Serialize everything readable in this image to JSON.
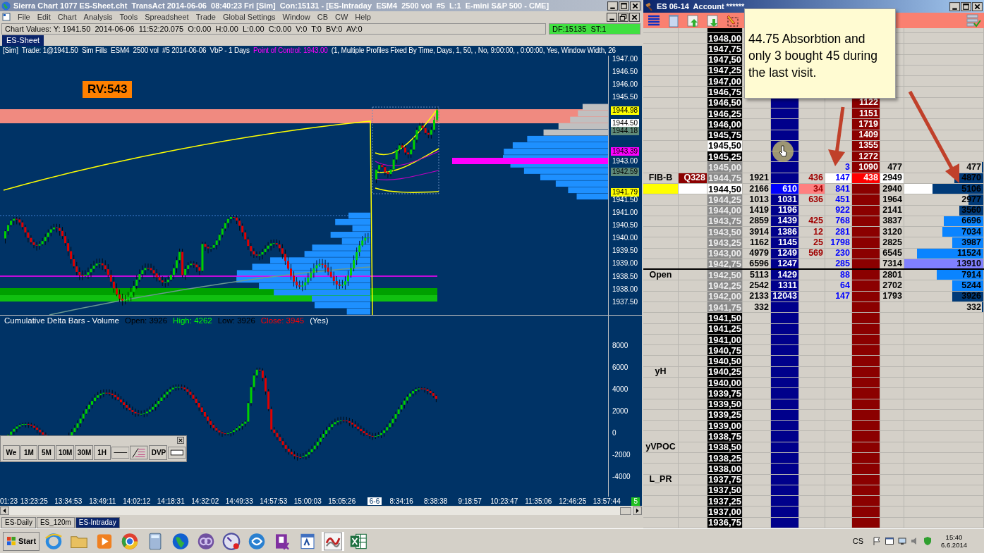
{
  "chart_window": {
    "title": "Sierra Chart 1077 ES-Sheet.cht  TransAct 2014-06-06  08:40:23 Fri [Sim]  Con:15131 - [ES-Intraday  ESM4  2500 vol  #5  L:1  E-mini S&P 500 - CME]",
    "menu": [
      "File",
      "Edit",
      "Chart",
      "Analysis",
      "Tools",
      "Spreadsheet",
      "Trade",
      "Global Settings",
      "Window",
      "CB",
      "CW",
      "Help"
    ],
    "chart_values": "Chart Values: Y: 1941.50  2014-06-06  11:52:20.075  O:0.00  H:0.00  L:0.00  C:0.00  V:0  T:0  BV:0  AV:0",
    "status": "DF:15135  ST:1",
    "sheet_tabs": [
      {
        "label": "ES-Sheet",
        "selected": true
      }
    ],
    "study_info": [
      {
        "text": "[Sim]  Trade: 1@1941.50  Sim Fills  ESM4  2500 vol  #5 2014-06-06  VbP - 1 Days  ",
        "color": "#ffffff"
      },
      {
        "text": "Point of Control: 1943.00",
        "color": "#ff00ff"
      },
      {
        "text": "  (1, Multiple Profiles Fixed By Time, Days, 1, 50, , No, 9:00:00, , 0:00:00, Yes, Window Width, 26",
        "color": "#ffffff"
      }
    ],
    "rv_badge": "RV:543",
    "price_axis": [
      "1947.00",
      "1946.50",
      "1946.00",
      "1945.50",
      "1943.00",
      "1941.50",
      "1941.00",
      "1940.50",
      "1940.00",
      "1939.50",
      "1939.00",
      "1938.50",
      "1938.00",
      "1937.50"
    ],
    "price_markers": [
      {
        "text": "1944.98",
        "color": "#ffff00"
      },
      {
        "text": "1944.50",
        "color": "#ffffff"
      },
      {
        "text": "1944.18",
        "color": "#5f8a7a"
      },
      {
        "text": "1943.39",
        "color": "#ff00ff"
      },
      {
        "text": "1942.59",
        "color": "#5f8a7a"
      },
      {
        "text": "1941.79",
        "color": "#ffff00"
      }
    ],
    "delta_info": [
      {
        "text": "Cumulative Delta Bars - Volume",
        "color": "#ffffff"
      },
      {
        "text": "Open: 3926",
        "color": "#000000"
      },
      {
        "text": "High: 4262",
        "color": "#00ff00"
      },
      {
        "text": "Low: 3926",
        "color": "#000000"
      },
      {
        "text": "Close: 3945",
        "color": "#ff0000"
      },
      {
        "text": "(Yes)",
        "color": "#ffffff"
      }
    ],
    "delta_axis": [
      "8000",
      "6000",
      "4000",
      "2000",
      "0",
      "-2000",
      "-4000"
    ],
    "time_axis": [
      {
        "text": "01:23",
        "kind": "time"
      },
      {
        "text": "13:23:25",
        "kind": "time"
      },
      {
        "text": "13:34:53",
        "kind": "time"
      },
      {
        "text": "13:49:11",
        "kind": "time"
      },
      {
        "text": "14:02:12",
        "kind": "time"
      },
      {
        "text": "14:18:31",
        "kind": "time"
      },
      {
        "text": "14:32:02",
        "kind": "time"
      },
      {
        "text": "14:49:33",
        "kind": "time"
      },
      {
        "text": "14:57:53",
        "kind": "time"
      },
      {
        "text": "15:00:03",
        "kind": "time"
      },
      {
        "text": "15:05:26",
        "kind": "time"
      },
      {
        "text": "6-6",
        "kind": "date"
      },
      {
        "text": "8:34:16",
        "kind": "time"
      },
      {
        "text": "8:38:38",
        "kind": "time"
      },
      {
        "text": "9:18:57",
        "kind": "time"
      },
      {
        "text": "10:23:47",
        "kind": "time"
      },
      {
        "text": "11:35:06",
        "kind": "time"
      },
      {
        "text": "12:46:25",
        "kind": "time"
      },
      {
        "text": "13:57:44",
        "kind": "time"
      }
    ],
    "page_badge": "5",
    "toolbar": [
      {
        "kind": "text",
        "label": "We"
      },
      {
        "kind": "text",
        "label": "1M"
      },
      {
        "kind": "text",
        "label": "5M"
      },
      {
        "kind": "text",
        "label": "10M"
      },
      {
        "kind": "text",
        "label": "30M"
      },
      {
        "kind": "text",
        "label": "1H"
      },
      {
        "kind": "line"
      },
      {
        "kind": "fib"
      },
      {
        "kind": "text",
        "label": "DVP"
      },
      {
        "kind": "rect"
      }
    ],
    "bottom_tabs": [
      {
        "label": "ES-Daily",
        "selected": false
      },
      {
        "label": "ES_120m",
        "selected": false
      },
      {
        "label": "ES-Intraday",
        "selected": true
      }
    ]
  },
  "dom_window": {
    "title": "ES 06-14  Account ******",
    "rows": [
      {
        "price": "1948,00",
        "highlighted": false,
        "traded": false,
        "kind": "normal",
        "rule_below": false
      },
      {
        "price": "1947,75",
        "highlighted": false,
        "traded": false,
        "kind": "normal",
        "rule_below": false
      },
      {
        "price": "1947,50",
        "highlighted": false,
        "traded": false,
        "kind": "normal",
        "rule_below": false
      },
      {
        "price": "1947,25",
        "highlighted": false,
        "traded": false,
        "kind": "normal",
        "rule_below": false
      },
      {
        "price": "1947,00",
        "highlighted": false,
        "traded": false,
        "kind": "normal",
        "rule_below": false
      },
      {
        "price": "1946,75",
        "highlighted": false,
        "traded": false,
        "kind": "normal",
        "rule_below": false
      },
      {
        "price": "1946,50",
        "highlighted": false,
        "traded": false,
        "kind": "normal",
        "rule_below": false,
        "ask": "1122"
      },
      {
        "price": "1946,25",
        "highlighted": false,
        "traded": false,
        "kind": "normal",
        "rule_below": false,
        "ask": "1151"
      },
      {
        "price": "1946,00",
        "highlighted": false,
        "traded": false,
        "kind": "normal",
        "rule_below": false,
        "ask": "1719"
      },
      {
        "price": "1945,75",
        "highlighted": false,
        "traded": false,
        "kind": "normal",
        "rule_below": false,
        "ask": "1409"
      },
      {
        "price": "1945,50",
        "highlighted": true,
        "kind": "normal",
        "rule_below": false,
        "ask": "1355"
      },
      {
        "price": "1945,25",
        "highlighted": false,
        "traded": false,
        "kind": "normal",
        "rule_below": false,
        "ask": "1272"
      },
      {
        "price": "1945,00",
        "highlighted": false,
        "traded": true,
        "kind": "normal",
        "rule_below": false,
        "column_7": "3",
        "ask": "1090",
        "column_9": "477",
        "bar_value": "477",
        "level": 0.02,
        "color": "#003a78"
      },
      {
        "price": "1944,75",
        "highlighted": false,
        "traded": true,
        "kind": "best_ask",
        "rule_below": false,
        "label": "FIB-B",
        "tag": "Q328",
        "volume": "1921",
        "column_6": "436",
        "column_7": "147",
        "ask": "438",
        "column_9": "2949",
        "bar_value": "4870",
        "level": 0.37,
        "color": "#003a78"
      },
      {
        "price": "1944,50",
        "highlighted": true,
        "kind": "last",
        "rule_below": false,
        "volume": "2166",
        "bid": "610",
        "column_6": "34",
        "column_7": "841",
        "column_9": "2940",
        "bar_value": "5106",
        "level": 0.64,
        "color": "#003a78"
      },
      {
        "price": "1944,25",
        "highlighted": false,
        "traded": true,
        "kind": "normal",
        "rule_below": false,
        "volume": "1013",
        "bid": "1031",
        "column_6": "636",
        "column_7": "451",
        "column_9": "1964",
        "bar_value": "2977",
        "level": 0.19,
        "color": "#003a78"
      },
      {
        "price": "1944,00",
        "highlighted": false,
        "traded": true,
        "kind": "normal",
        "rule_below": false,
        "volume": "1419",
        "bid": "1196",
        "column_7": "922",
        "column_9": "2141",
        "bar_value": "3560",
        "level": 0.3,
        "color": "#003a78"
      },
      {
        "price": "1943,75",
        "highlighted": false,
        "traded": true,
        "kind": "normal",
        "rule_below": false,
        "volume": "2859",
        "bid": "1439",
        "column_6": "425",
        "column_7": "768",
        "column_9": "3837",
        "bar_value": "6696",
        "level": 0.5,
        "color": "#0a84ff"
      },
      {
        "price": "1943,50",
        "highlighted": false,
        "traded": true,
        "kind": "normal",
        "rule_below": false,
        "volume": "3914",
        "bid": "1386",
        "column_6": "12",
        "column_7": "281",
        "column_9": "3120",
        "bar_value": "7034",
        "level": 0.52,
        "color": "#0a84ff"
      },
      {
        "price": "1943,25",
        "highlighted": false,
        "traded": true,
        "kind": "normal",
        "rule_below": false,
        "volume": "1162",
        "bid": "1145",
        "column_6": "25",
        "column_7": "1798",
        "column_9": "2825",
        "bar_value": "3987",
        "level": 0.39,
        "color": "#0a84ff"
      },
      {
        "price": "1943,00",
        "highlighted": false,
        "traded": true,
        "kind": "normal",
        "rule_below": false,
        "volume": "4979",
        "bid": "1249",
        "column_6": "569",
        "column_7": "230",
        "column_9": "6545",
        "bar_value": "11524",
        "level": 0.84,
        "color": "#0a84ff"
      },
      {
        "price": "1942,75",
        "highlighted": false,
        "traded": true,
        "kind": "normal",
        "rule_below": true,
        "volume": "6596",
        "bid": "1247",
        "column_7": "285",
        "column_9": "7314",
        "bar_value": "13910",
        "level": 1,
        "color": "#8080ff"
      },
      {
        "price": "1942,50",
        "highlighted": false,
        "traded": true,
        "kind": "normal",
        "rule_below": false,
        "label": "Open",
        "volume": "5113",
        "bid": "1429",
        "column_7": "88",
        "column_9": "2801",
        "bar_value": "7914",
        "level": 0.59,
        "color": "#0a84ff"
      },
      {
        "price": "1942,25",
        "highlighted": false,
        "traded": true,
        "kind": "normal",
        "rule_below": false,
        "volume": "2542",
        "bid": "1311",
        "column_7": "64",
        "column_9": "2702",
        "bar_value": "5244",
        "level": 0.39,
        "color": "#0a84ff"
      },
      {
        "price": "1942,00",
        "highlighted": false,
        "traded": true,
        "kind": "normal",
        "rule_below": false,
        "volume": "2133",
        "bid": "12043",
        "column_7": "147",
        "column_9": "1793",
        "bar_value": "3926",
        "level": 0.39,
        "color": "#003a78"
      },
      {
        "price": "1941,75",
        "highlighted": false,
        "traded": true,
        "kind": "normal",
        "rule_below": false,
        "volume": "332",
        "bar_value": "332",
        "level": 0.02,
        "color": "#003a78"
      },
      {
        "price": "1941,50",
        "highlighted": false,
        "traded": false,
        "kind": "normal",
        "rule_below": false
      },
      {
        "price": "1941,25",
        "highlighted": false,
        "traded": false,
        "kind": "normal",
        "rule_below": false
      },
      {
        "price": "1941,00",
        "highlighted": false,
        "traded": false,
        "kind": "normal",
        "rule_below": false
      },
      {
        "price": "1940,75",
        "highlighted": false,
        "traded": false,
        "kind": "normal",
        "rule_below": false
      },
      {
        "price": "1940,50",
        "highlighted": false,
        "traded": false,
        "kind": "normal",
        "rule_below": false
      },
      {
        "price": "1940,25",
        "highlighted": false,
        "traded": false,
        "kind": "normal",
        "rule_below": false,
        "label": "yH"
      },
      {
        "price": "1940,00",
        "highlighted": false,
        "traded": false,
        "kind": "normal",
        "rule_below": false
      },
      {
        "price": "1939,75",
        "highlighted": false,
        "traded": false,
        "kind": "normal",
        "rule_below": false
      },
      {
        "price": "1939,50",
        "highlighted": false,
        "traded": false,
        "kind": "normal",
        "rule_below": false
      },
      {
        "price": "1939,25",
        "highlighted": false,
        "traded": false,
        "kind": "normal",
        "rule_below": false
      },
      {
        "price": "1939,00",
        "highlighted": false,
        "traded": false,
        "kind": "normal",
        "rule_below": false
      },
      {
        "price": "1938,75",
        "highlighted": false,
        "traded": false,
        "kind": "normal",
        "rule_below": false
      },
      {
        "price": "1938,50",
        "highlighted": false,
        "traded": false,
        "kind": "normal",
        "rule_below": false,
        "label": "yVPOC"
      },
      {
        "price": "1938,25",
        "highlighted": false,
        "traded": false,
        "kind": "normal",
        "rule_below": false
      },
      {
        "price": "1938,00",
        "highlighted": false,
        "traded": false,
        "kind": "normal",
        "rule_below": false
      },
      {
        "price": "1937,75",
        "highlighted": false,
        "traded": false,
        "kind": "normal",
        "rule_below": false,
        "label": "L_PR"
      },
      {
        "price": "1937,50",
        "highlighted": false,
        "traded": false,
        "kind": "normal",
        "rule_below": false
      },
      {
        "price": "1937,25",
        "highlighted": false,
        "traded": false,
        "kind": "normal",
        "rule_below": false
      },
      {
        "price": "1937,00",
        "highlighted": false,
        "traded": false,
        "kind": "normal",
        "rule_below": false
      },
      {
        "price": "1936,75",
        "highlighted": false,
        "traded": false,
        "kind": "normal",
        "rule_below": false
      }
    ]
  },
  "note": "44.75 Absorbtion and only 3 bought 45 during the last visit.",
  "taskbar": {
    "start": "Start",
    "language": "CS",
    "time": "15:40",
    "date": "6.6.2014"
  }
}
